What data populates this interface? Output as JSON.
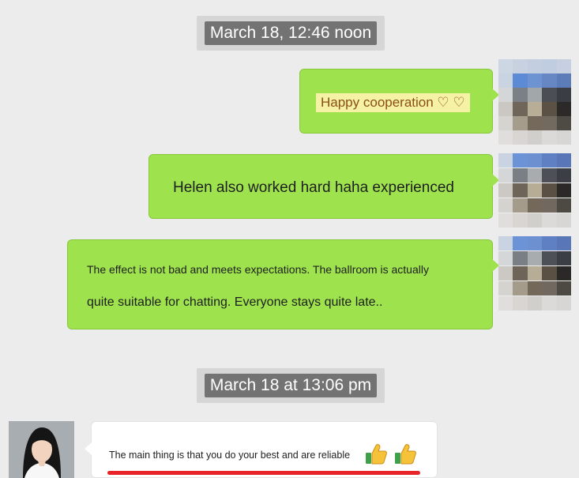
{
  "timestamps": {
    "first": "March 18, 12:46 noon",
    "second": "March 18 at 13:06 pm"
  },
  "messages": [
    {
      "side": "right",
      "text": "Happy cooperation ♡ ♡",
      "text_color": "#8a4f14"
    },
    {
      "side": "right",
      "text": "Helen also worked hard haha experienced"
    },
    {
      "side": "right",
      "line1": "The effect is not bad and meets expectations. The ballroom is actually",
      "line2": "quite suitable for chatting. Everyone stays quite late.."
    },
    {
      "side": "left",
      "text": "The main thing is that you do your best and are reliable"
    }
  ],
  "icons": [
    "thumbs-up-icon",
    "thumbs-up-icon"
  ],
  "colors": {
    "bubble_green": "#9ee34e",
    "bubble_white": "#ffffff",
    "timestamp_bg": "#737373",
    "underline_red": "#e8242a"
  }
}
